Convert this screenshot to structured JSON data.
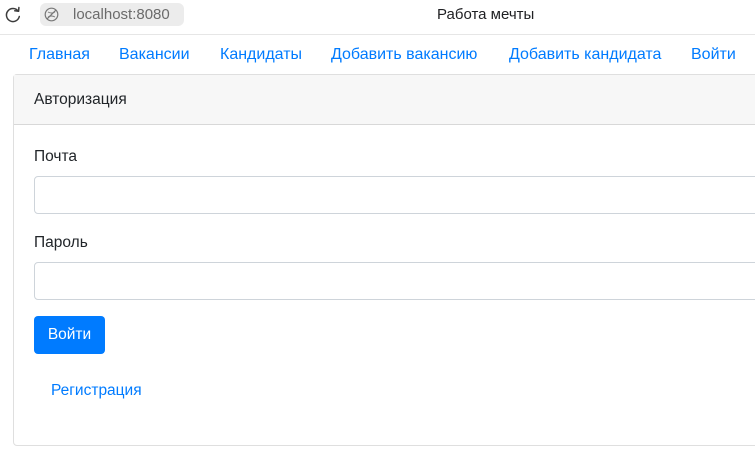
{
  "browser": {
    "address": "localhost:8080",
    "tab_title": "Работа мечты",
    "icons": [
      "reload-icon",
      "site-info-icon"
    ]
  },
  "nav": {
    "items": [
      {
        "label": "Главная"
      },
      {
        "label": "Вакансии"
      },
      {
        "label": "Кандидаты"
      },
      {
        "label": "Добавить вакансию"
      },
      {
        "label": "Добавить кандидата"
      },
      {
        "label": "Войти"
      }
    ]
  },
  "auth": {
    "header": "Авторизация",
    "email_label": "Почта",
    "email_value": "",
    "password_label": "Пароль",
    "password_value": "",
    "submit_label": "Войти",
    "register_label": "Регистрация"
  },
  "colors": {
    "accent": "#007bff",
    "card_header_bg": "#f7f7f7",
    "address_pill_bg": "#ececec"
  }
}
